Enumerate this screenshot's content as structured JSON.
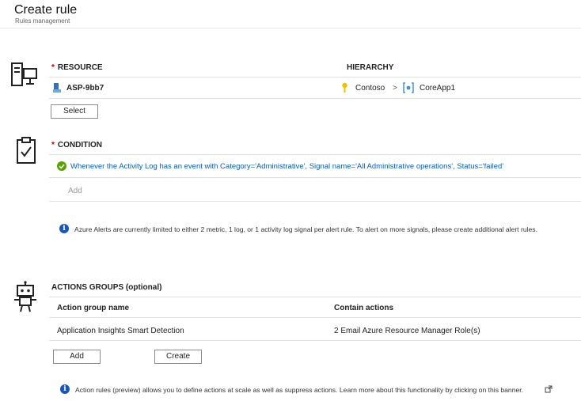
{
  "header": {
    "title": "Create rule",
    "subtitle": "Rules management"
  },
  "resource": {
    "label": "RESOURCE",
    "hierarchy_label": "HIERARCHY",
    "name": "ASP-9bb7",
    "hierarchy_parent": "Contoso",
    "hierarchy_separator": ">",
    "hierarchy_child": "CoreApp1",
    "select_label": "Select",
    "icon": "computer-icon"
  },
  "condition": {
    "label": "CONDITION",
    "text": "Whenever the Activity Log has an event with Category='Administrative', Signal name='All Administrative operations', Status='failed'",
    "add_label": "Add",
    "info": "Azure Alerts are currently limited to either 2 metric, 1 log, or 1 activity log signal per alert rule. To alert on more signals, please create additional alert rules.",
    "icon": "clipboard-check-icon"
  },
  "actions": {
    "label": "ACTIONS GROUPS (optional)",
    "columns": [
      "Action group name",
      "Contain actions"
    ],
    "rows": [
      [
        "Application Insights Smart Detection",
        "2 Email Azure Resource Manager Role(s)"
      ]
    ],
    "add_label": "Add",
    "create_label": "Create",
    "info": "Action rules (preview) allows you to define actions at scale as well as suppress actions. Learn more about this functionality by clicking on this banner.",
    "icon": "robot-icon"
  },
  "colors": {
    "link": "#0b5eb5",
    "required": "#c00000",
    "success": "#57a300",
    "info": "#1a56b8",
    "key": "#f2c200"
  }
}
